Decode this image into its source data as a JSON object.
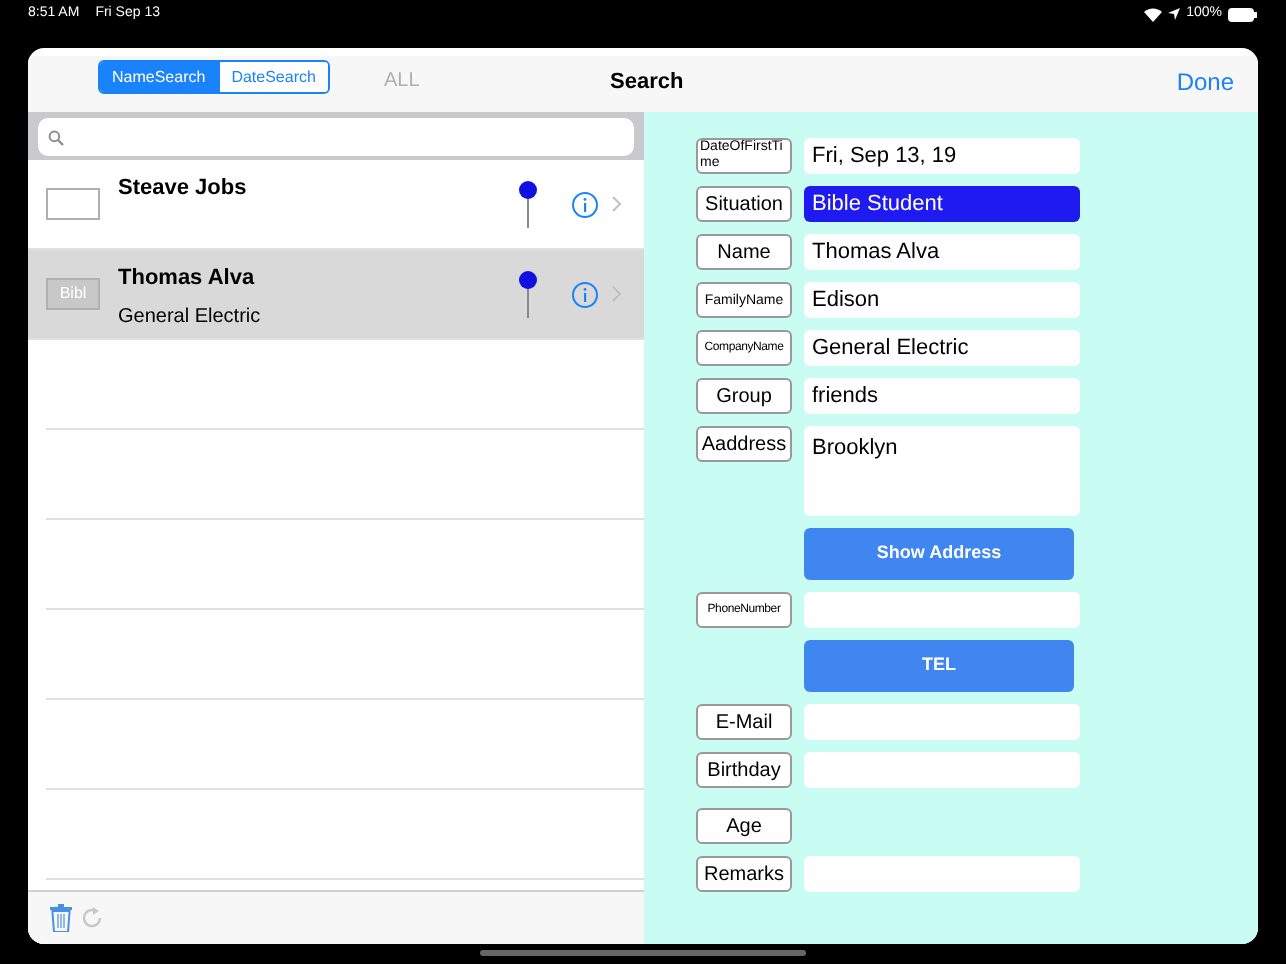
{
  "status_bar": {
    "time": "8:51 AM",
    "date": "Fri Sep 13",
    "battery": "100%"
  },
  "nav": {
    "segments": [
      {
        "label": "NameSearch",
        "selected": true
      },
      {
        "label": "DateSearch",
        "selected": false
      }
    ],
    "all_button": {
      "label": "ALL",
      "disabled": true
    },
    "title": "Search",
    "done": "Done"
  },
  "list": {
    "rows": [
      {
        "name": "Steave Jobs",
        "subtitle": null,
        "tag": null,
        "selected": false
      },
      {
        "name": "Thomas Alva",
        "subtitle": "General Electric",
        "tag": "Bibl",
        "selected": true
      }
    ]
  },
  "form": [
    {
      "kind": "field",
      "label": "DateOfFirstTime",
      "value": "Fri, Sep 13, 19",
      "highlighted": false
    },
    {
      "kind": "field",
      "label": "Situation",
      "value": "Bible Student",
      "highlighted": true
    },
    {
      "kind": "field",
      "label": "Name",
      "value": "Thomas Alva",
      "highlighted": false
    },
    {
      "kind": "field",
      "label": "FamilyName",
      "value": "Edison",
      "highlighted": false
    },
    {
      "kind": "field",
      "label": "CompanyName",
      "value": "General Electric",
      "highlighted": false
    },
    {
      "kind": "field",
      "label": "Group",
      "value": "friends",
      "highlighted": false
    },
    {
      "kind": "area",
      "label": "Aaddress",
      "value": "Brooklyn"
    },
    {
      "kind": "button",
      "label": "Show Address"
    },
    {
      "kind": "field",
      "label": "PhoneNumber",
      "highlighted": false
    },
    {
      "kind": "button",
      "label": "TEL"
    },
    {
      "kind": "field",
      "label": "E-Mail",
      "highlighted": false
    },
    {
      "kind": "field",
      "label": "Birthday",
      "highlighted": false
    },
    {
      "kind": "label",
      "label": "Age"
    },
    {
      "kind": "field",
      "label": "Remarks",
      "highlighted": false
    }
  ]
}
